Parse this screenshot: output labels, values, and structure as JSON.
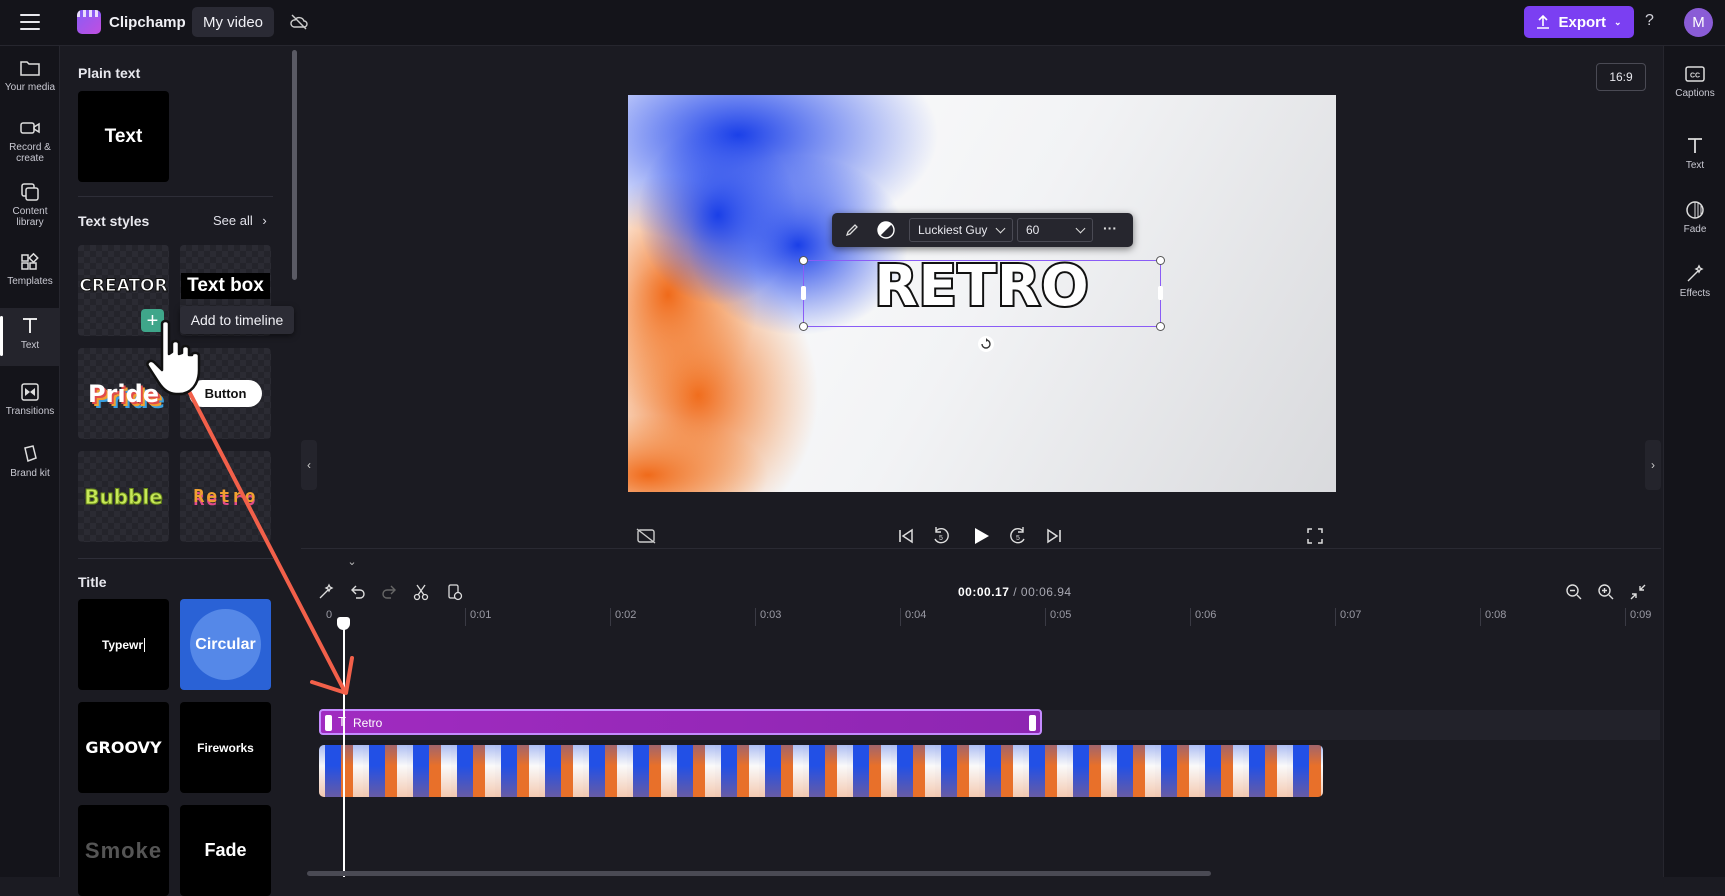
{
  "topbar": {
    "app_name": "Clipchamp",
    "project_name": "My video",
    "export_label": "Export",
    "help_label": "?",
    "avatar_initial": "M"
  },
  "left_rail": {
    "items": [
      {
        "label": "Your media",
        "icon": "folder-icon"
      },
      {
        "label": "Record & create",
        "icon": "camera-icon"
      },
      {
        "label": "Content library",
        "icon": "library-icon"
      },
      {
        "label": "Templates",
        "icon": "templates-icon"
      },
      {
        "label": "Text",
        "icon": "text-icon",
        "active": true
      },
      {
        "label": "Transitions",
        "icon": "transitions-icon"
      },
      {
        "label": "Brand kit",
        "icon": "brand-kit-icon"
      }
    ]
  },
  "panel": {
    "plain_text_heading": "Plain text",
    "plain_text_tile": "Text",
    "text_styles_heading": "Text styles",
    "see_all": "See all",
    "styles": [
      "CREATOR",
      "Text box",
      "Pride",
      "Button",
      "Bubble",
      "Retro"
    ],
    "title_heading": "Title",
    "titles": [
      "Typewr",
      "Circular",
      "GROOVY",
      "Fireworks",
      "Smoke",
      "Fade"
    ],
    "tooltip": "Add to timeline"
  },
  "preview": {
    "aspect_ratio": "16:9",
    "overlay_text": "RETRO",
    "font_name": "Luckiest Guy",
    "font_size": "60",
    "more_label": "···"
  },
  "timeline": {
    "current_time": "00:00.17",
    "separator": " / ",
    "total_time": "00:06.94",
    "ruler_ticks": [
      "0",
      "0:01",
      "0:02",
      "0:03",
      "0:04",
      "0:05",
      "0:06",
      "0:07",
      "0:08",
      "0:09"
    ],
    "text_clip_label": "Retro"
  },
  "right_rail": {
    "items": [
      {
        "label": "Captions",
        "icon": "captions-icon"
      },
      {
        "label": "Text",
        "icon": "text-icon"
      },
      {
        "label": "Fade",
        "icon": "fade-icon"
      },
      {
        "label": "Effects",
        "icon": "effects-icon"
      }
    ]
  },
  "colors": {
    "accent": "#7b3ff2",
    "clip_purple": "#9b2bc0",
    "background": "#1b1b22",
    "arrow": "#f2604a"
  }
}
